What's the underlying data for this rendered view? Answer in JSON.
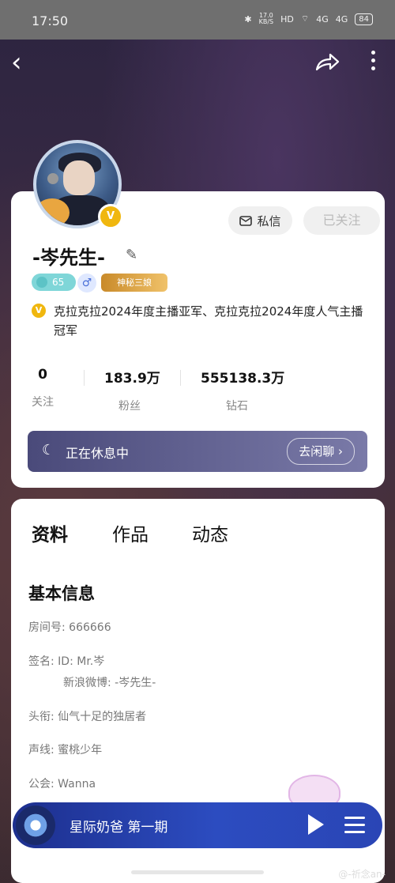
{
  "status_bar": {
    "time": "17:50",
    "speed_value": "17.0",
    "speed_unit": "KB/S",
    "hd": "HD",
    "net1": "4G",
    "net2": "4G",
    "battery": "84"
  },
  "profile": {
    "message_button": "私信",
    "follow_button": "已关注",
    "name": "-岑先生-",
    "level": "65",
    "gender_symbol": "♂",
    "guardian_badge": "神秘三娘",
    "verified_mark": "V",
    "certification": "克拉克拉2024年度主播亚军、克拉克拉2024年度人气主播冠军",
    "stats": [
      {
        "value": "0",
        "label": "关注"
      },
      {
        "value": "183.9万",
        "label": "粉丝"
      },
      {
        "value": "555138.3万",
        "label": "钻石"
      }
    ],
    "rest_status": "正在休息中",
    "chat_button": "去闲聊 ›"
  },
  "tabs": [
    "资料",
    "作品",
    "动态"
  ],
  "basic_info": {
    "title": "基本信息",
    "room": "房间号: 666666",
    "signature_line1": "签名: ID: Mr.岑",
    "signature_line2": "新浪微博: -岑先生-",
    "title_field": "头衔: 仙气十足的独居者",
    "voice": "声线: 蜜桃少年",
    "guild": "公会: Wanna"
  },
  "player": {
    "title": "星际奶爸 第一期"
  },
  "watermark": "@-祈念an-",
  "colors": {
    "accent": "#f0b70f",
    "player": "#2c4cc0",
    "rest_banner": "#5a5a8a"
  }
}
